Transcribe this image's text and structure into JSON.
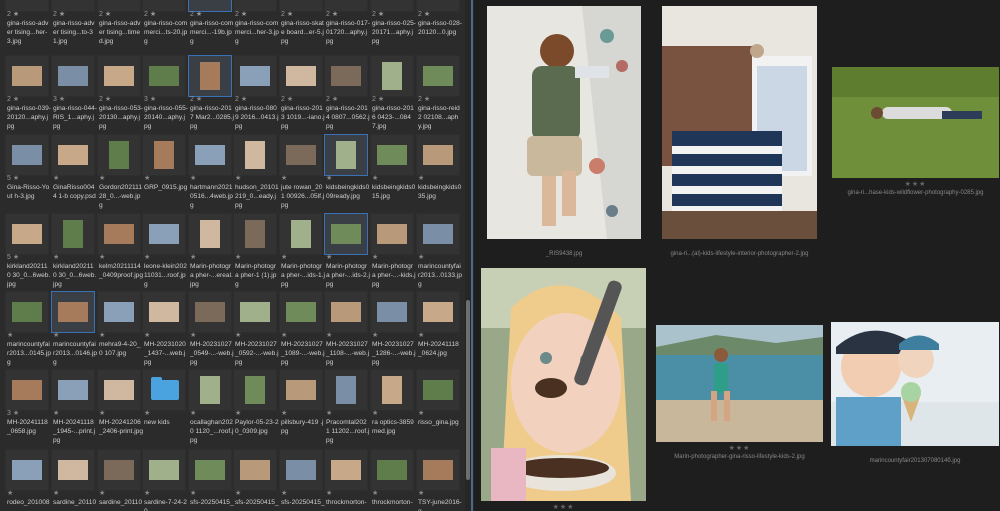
{
  "left_grid": {
    "top_row": [
      {
        "rating": "2",
        "name": "gina-risso-adver tising...her-3.jpg"
      },
      {
        "rating": "2",
        "name": "gina-risso-adver tising...to-31.jpg"
      },
      {
        "rating": "2",
        "name": "gina-risso-adver tising...timed.jpg"
      },
      {
        "rating": "2",
        "name": "gina-risso-com merci...ts-20.jpg"
      },
      {
        "rating": "2",
        "name": "gina-risso-com merci...-19b.jpg"
      },
      {
        "rating": "2",
        "name": "gina-risso-com merci...her-3.jpg"
      },
      {
        "rating": "2",
        "name": "gina-risso-skate board...er-5.jpg"
      },
      {
        "rating": "2",
        "name": "gina-risso-017-01720...aphy.jpg"
      },
      {
        "rating": "2",
        "name": "gina-risso-025-20171...aphy.jpg"
      },
      {
        "rating": "2",
        "name": "gina-risso-028-20120...0.jpg"
      }
    ],
    "rows": [
      [
        {
          "rating": "2",
          "name": "gina-risso-039-20120...aphy.jpg"
        },
        {
          "rating": "3",
          "name": "gina-risso-044-RIS_1...aphy.jpg"
        },
        {
          "rating": "2",
          "name": "gina-risso-053-20130...aphy.jpg"
        },
        {
          "rating": "3",
          "name": "gina-risso-055-20140...aphy.jpg"
        },
        {
          "rating": "2",
          "name": "gina-risso-2017 Mar2...0285.jpg"
        },
        {
          "rating": "2",
          "name": "gina-risso-0809 2016...0413.jpg"
        },
        {
          "rating": "2",
          "name": "gina-risso-2013 1019...-iano.jpg"
        },
        {
          "rating": "2",
          "name": "gina-risso-2014 0807...0562.jpg"
        },
        {
          "rating": "2",
          "name": "gina-risso-2016 0423-...0847.jpg"
        },
        {
          "rating": "2",
          "name": "gina-risso-reid2 02108...aphy.jpg"
        }
      ],
      [
        {
          "rating": "5",
          "name": "Gina-Risso-Yout h-3.jpg"
        },
        {
          "rating": "",
          "name": "GinaRisso0044 1-b copy.psd"
        },
        {
          "rating": "",
          "name": "Gordon202111 28_0...-web.jpg"
        },
        {
          "rating": "",
          "name": "GRP_0915.jpg"
        },
        {
          "rating": "",
          "name": "hartmann2021 0516...4web.jpg"
        },
        {
          "rating": "",
          "name": "hudson_20101 219_0...eady.jpg"
        },
        {
          "rating": "",
          "name": "jute rowan_201 00926...05lf.jpg"
        },
        {
          "rating": "",
          "name": "kidsbeingkids0 09ready.jpg"
        },
        {
          "rating": "",
          "name": "kidsbeingkids0 15.jpg"
        },
        {
          "rating": "",
          "name": "kidsbeingkids0 35.jpg"
        }
      ],
      [
        {
          "rating": "5",
          "name": "kirkland202110 30_0...6web.jpg"
        },
        {
          "rating": "",
          "name": "kirkland202110 30_0...6web.jpg"
        },
        {
          "rating": "",
          "name": "kelm20211114 _0409proof.jpg"
        },
        {
          "rating": "",
          "name": "leone-klein202 11031...roof.jpg"
        },
        {
          "rating": "",
          "name": "Marin-photogra pher-...ereal.jpg"
        },
        {
          "rating": "",
          "name": "Marin-photogra pher-1 (1).jpg"
        },
        {
          "rating": "",
          "name": "Marin-photogra pher-...ids-1.jpg"
        },
        {
          "rating": "",
          "name": "Marin-photogra pher-...ids-2.jpg"
        },
        {
          "rating": "",
          "name": "Marin-photogra pher-...-kids.jpg"
        },
        {
          "rating": "",
          "name": "marincountyfai r2013...0133.jpg"
        }
      ],
      [
        {
          "rating": "",
          "name": "marincountyfai r2013...0145.jpg"
        },
        {
          "rating": "",
          "name": "marincountyfai r2013...0146.jpg"
        },
        {
          "rating": "",
          "name": "mehra9-4-20_0 107.jpg"
        },
        {
          "rating": "",
          "name": "MH-20231020_1437-...web.jpg"
        },
        {
          "rating": "",
          "name": "MH-20231027_0549-...-web.jpg"
        },
        {
          "rating": "",
          "name": "MH-20231027_0592-...-web.jpg"
        },
        {
          "rating": "",
          "name": "MH-20231027_1089-...-web.jpg"
        },
        {
          "rating": "",
          "name": "MH-20231027_1108-...-web.jpg"
        },
        {
          "rating": "",
          "name": "MH-20231027_1286-...-web.jpg"
        },
        {
          "rating": "",
          "name": "MH-20241118_0624.jpg"
        }
      ],
      [
        {
          "rating": "3",
          "name": "MH-20241118_0658.jpg"
        },
        {
          "rating": "",
          "name": "MH-20241118_1945-...print.jpg"
        },
        {
          "rating": "",
          "name": "MH-20241206_2406-print.jpg"
        },
        {
          "rating": "",
          "name": "new kids"
        },
        {
          "rating": "",
          "name": "ocallaghan2020 1120_...roof.jpg"
        },
        {
          "rating": "",
          "name": "Paylor-05-23-2 0_0309.jpg"
        },
        {
          "rating": "",
          "name": "pillsbury-419 .jpg"
        },
        {
          "rating": "",
          "name": "Pracomtal2021 11202...roof.jpg"
        },
        {
          "rating": "",
          "name": "ra optics-3859 med.jpg"
        },
        {
          "rating": "",
          "name": "risso_gina.jpg"
        }
      ],
      [
        {
          "rating": "",
          "name": "rodeo_201008"
        },
        {
          "rating": "",
          "name": "sardine_20110"
        },
        {
          "rating": "",
          "name": "sardine_20110"
        },
        {
          "rating": "",
          "name": "sardine-7-24-20"
        },
        {
          "rating": "",
          "name": "sfs-20250415_"
        },
        {
          "rating": "",
          "name": "sfs-20250415_"
        },
        {
          "rating": "",
          "name": "sfs-20250415_"
        },
        {
          "rating": "",
          "name": "throckmorton-"
        },
        {
          "rating": "",
          "name": "throckmorton-"
        },
        {
          "rating": "",
          "name": "TSY-june2016-g"
        }
      ]
    ]
  },
  "right_panel": {
    "captions": {
      "climb": "_RIS9438.jpg",
      "bedroom": "gina-ri...(al)-kids-lifestyle-interior-photographer-2.jpg",
      "field": "gina-ri...hase-kids-wildflower-photography-0285.jpg",
      "beach": "Marin-photographer-gina-risso-lifestyle-kids-2.jpg",
      "icecream": "marincountyfair20130708014б.jpg"
    },
    "stars": "★★★"
  },
  "colors": {
    "accent": "#3b6fb6",
    "folder": "#4aa3df"
  }
}
